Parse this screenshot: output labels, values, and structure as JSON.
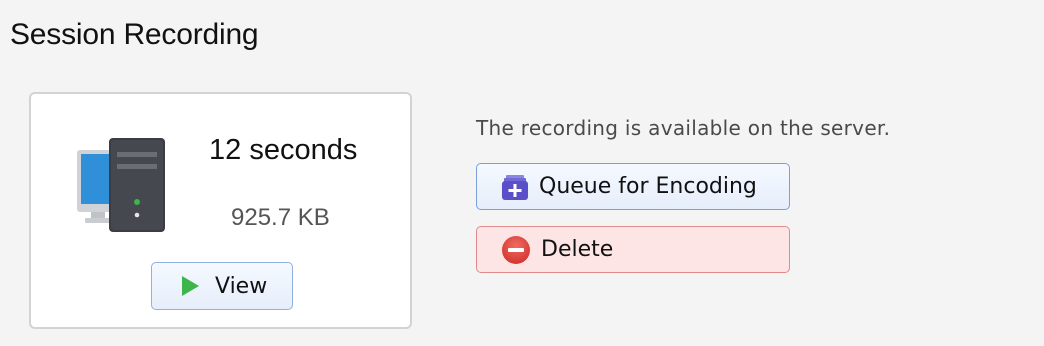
{
  "section": {
    "title": "Session Recording"
  },
  "recording": {
    "duration": "12 seconds",
    "size": "925.7 KB",
    "view_label": "View",
    "status": "The recording is available on the server."
  },
  "actions": {
    "queue_label": "Queue for Encoding",
    "delete_label": "Delete"
  },
  "icons": {
    "computer": "computer-tower-icon",
    "play": "play-icon",
    "queue": "queue-add-icon",
    "delete": "delete-minus-icon"
  },
  "colors": {
    "play_green": "#3cb54a",
    "queue_purple": "#5b4fc9",
    "delete_red": "#e0413a",
    "screen_blue": "#2f8fd8"
  }
}
